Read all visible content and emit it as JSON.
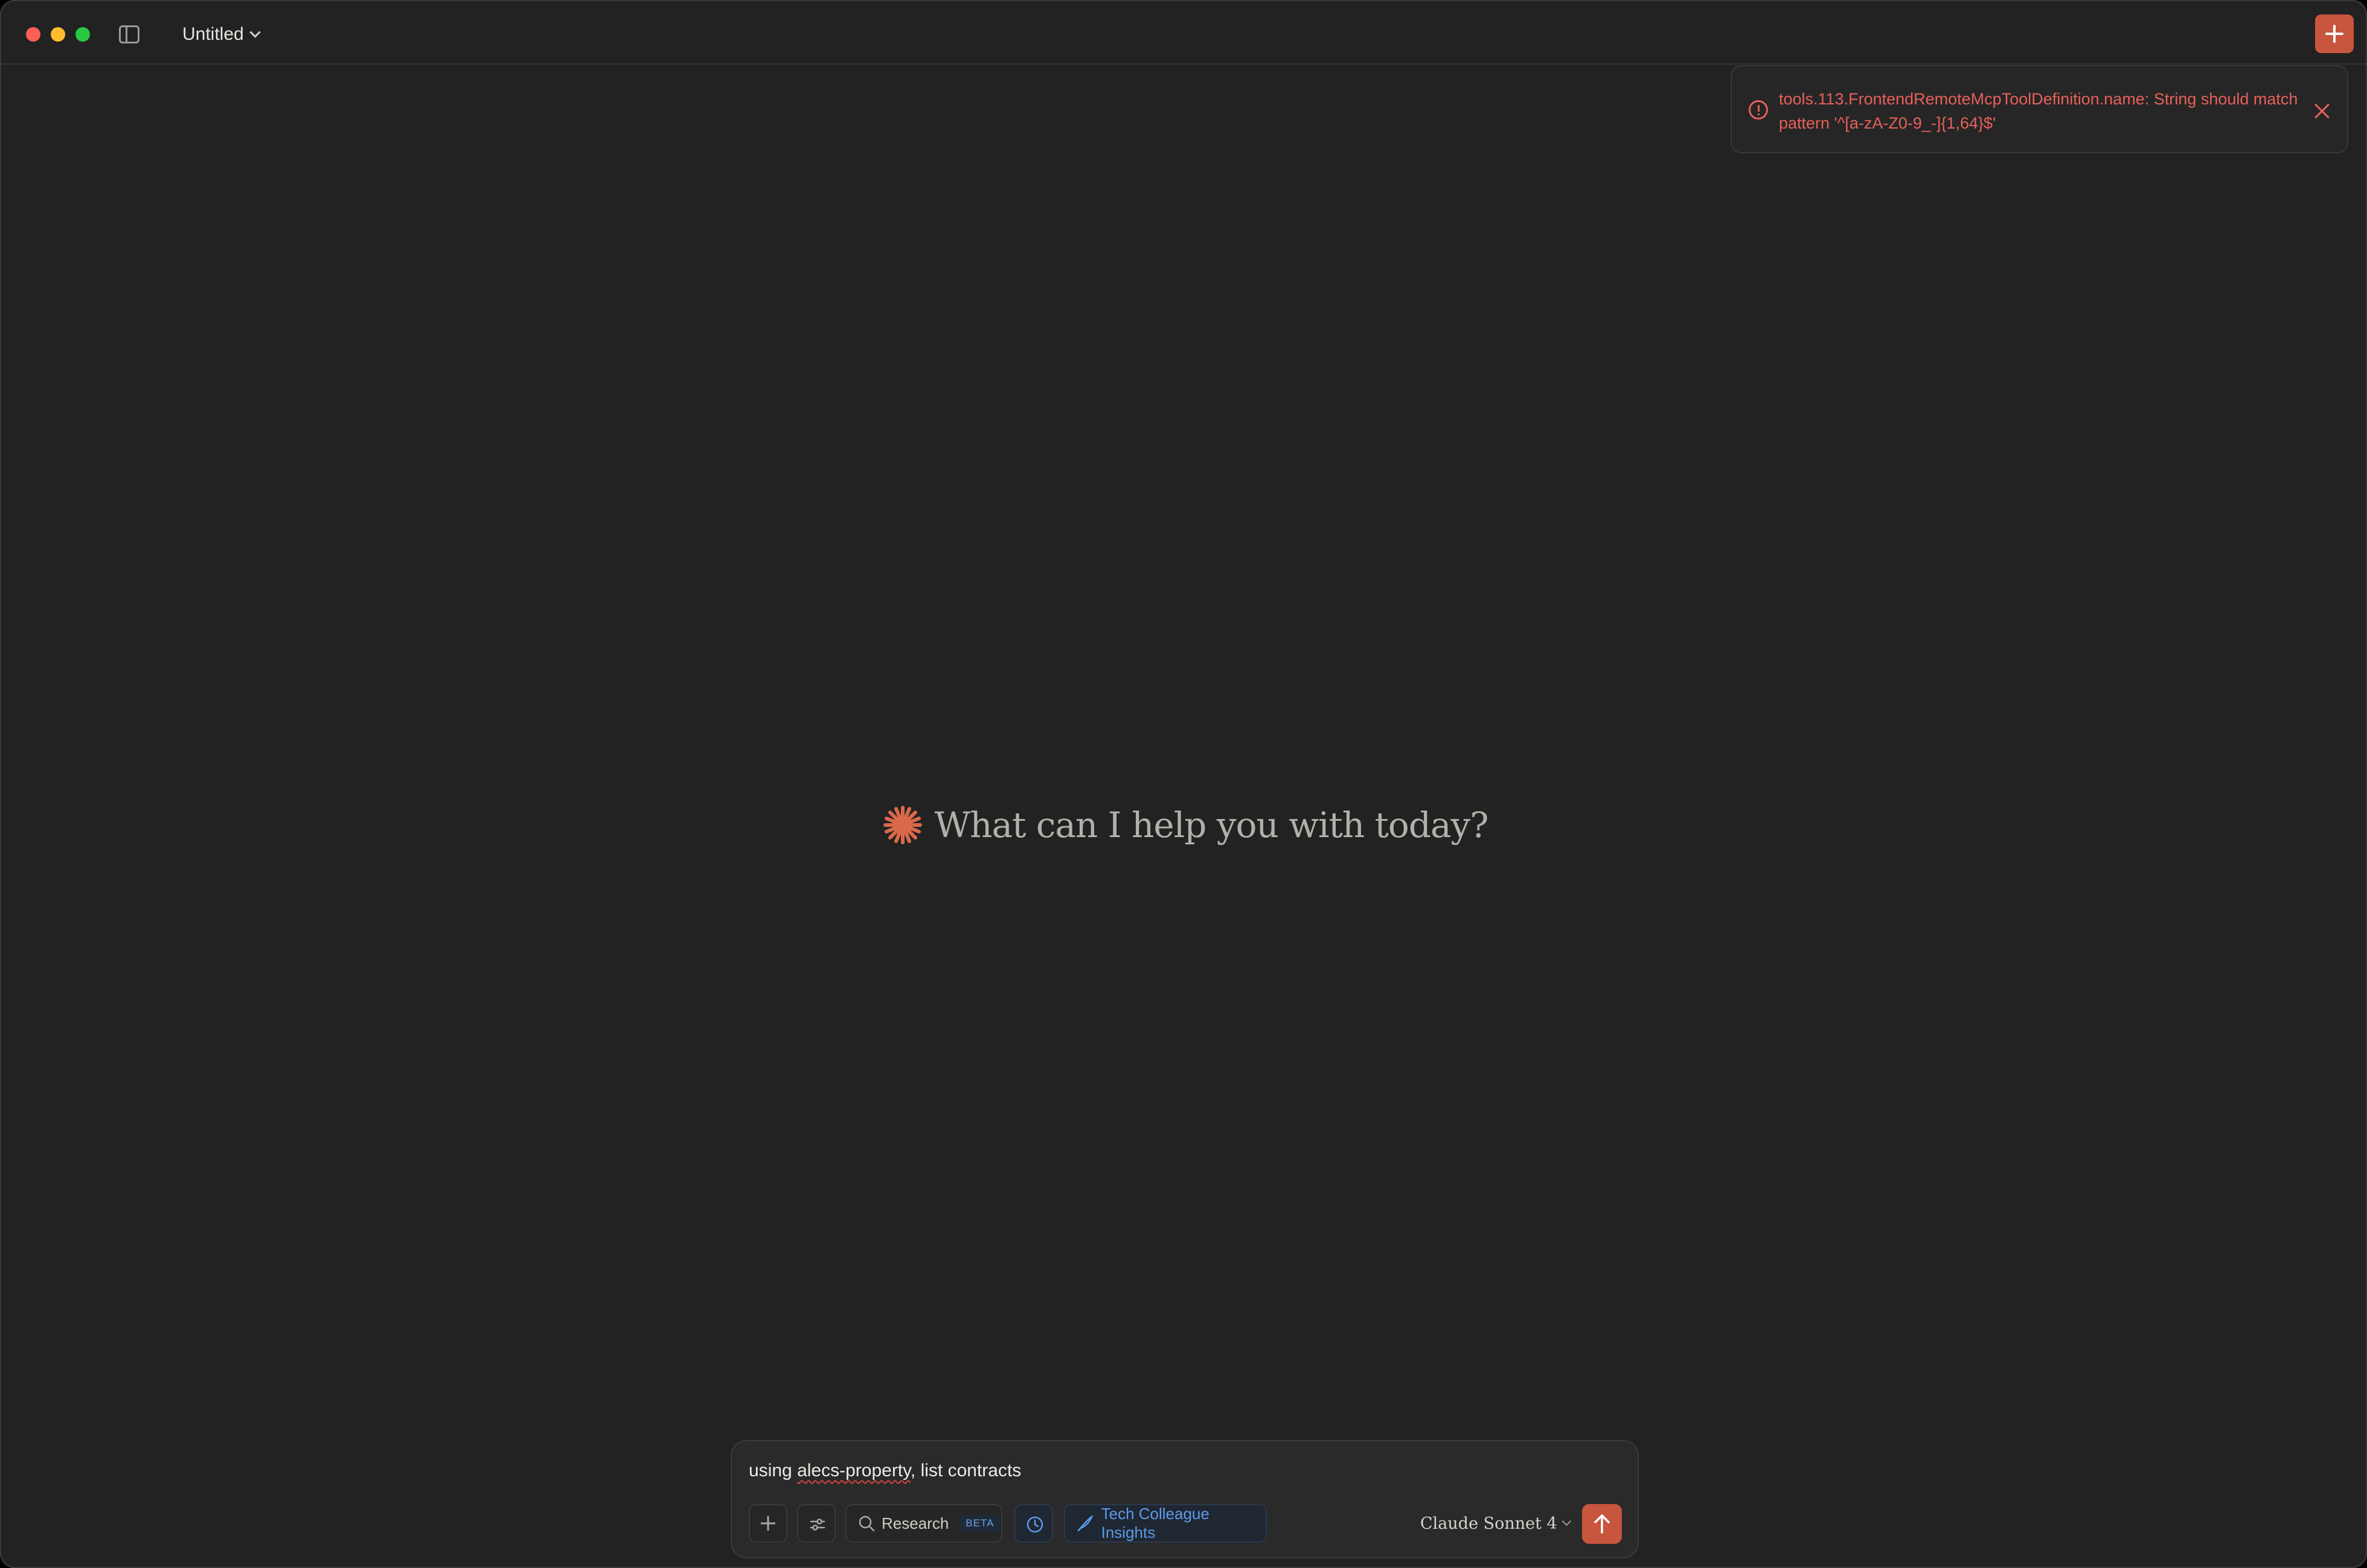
{
  "window": {
    "title": "Untitled"
  },
  "toast": {
    "message": "tools.113.FrontendRemoteMcpToolDefinition.name: String should match pattern '^[a-zA-Z0-9_-]{1,64}$'",
    "color": "#e8605a"
  },
  "welcome": {
    "heading": "What can I help you with today?",
    "icon": "claude-spark-icon",
    "accent": "#d9694a"
  },
  "composer": {
    "input_value_misspelled": "alecs-property",
    "input_prefix": "using ",
    "input_suffix": ", list contracts",
    "research_label": "Research",
    "research_badge": "BETA",
    "insights_label": "Tech Colleague Insights",
    "model_label": "Claude Sonnet 4"
  },
  "colors": {
    "brand": "#c8553d",
    "background": "#222222",
    "link_blue": "#5b9be8"
  }
}
